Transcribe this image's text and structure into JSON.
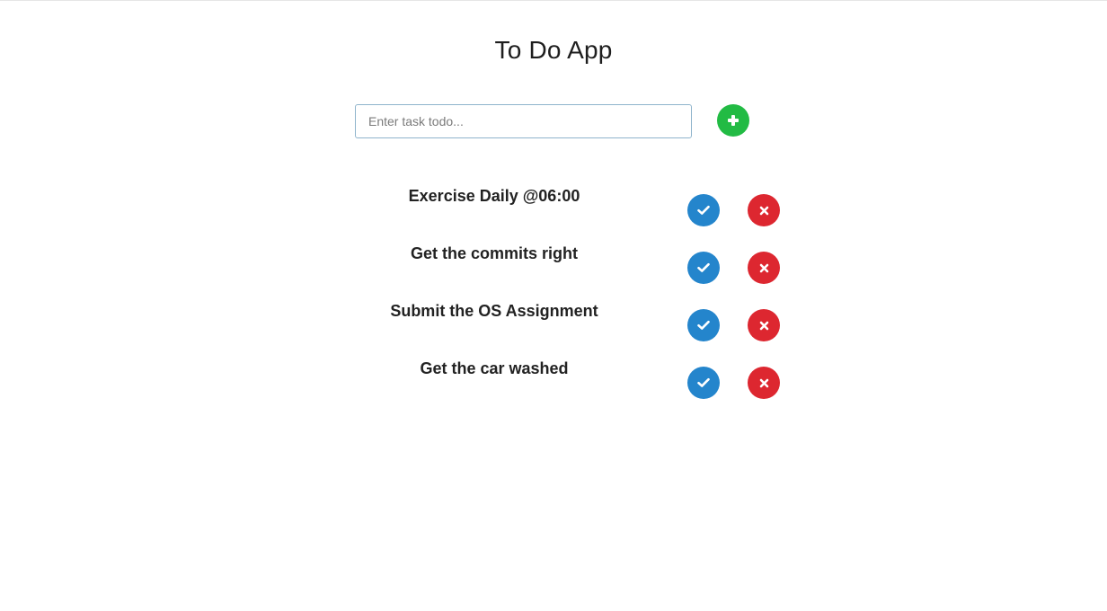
{
  "app": {
    "title": "To Do App"
  },
  "input": {
    "placeholder": "Enter task todo...",
    "value": ""
  },
  "buttons": {
    "add_icon": "plus-icon",
    "done_icon": "check-icon",
    "delete_icon": "times-icon"
  },
  "colors": {
    "add": "#22bb44",
    "done": "#2485cc",
    "delete": "#dd2730",
    "text": "#222222"
  },
  "tasks": [
    {
      "text": "Exercise Daily @06:00"
    },
    {
      "text": "Get the commits right"
    },
    {
      "text": "Submit the OS Assignment"
    },
    {
      "text": "Get the car washed"
    }
  ]
}
